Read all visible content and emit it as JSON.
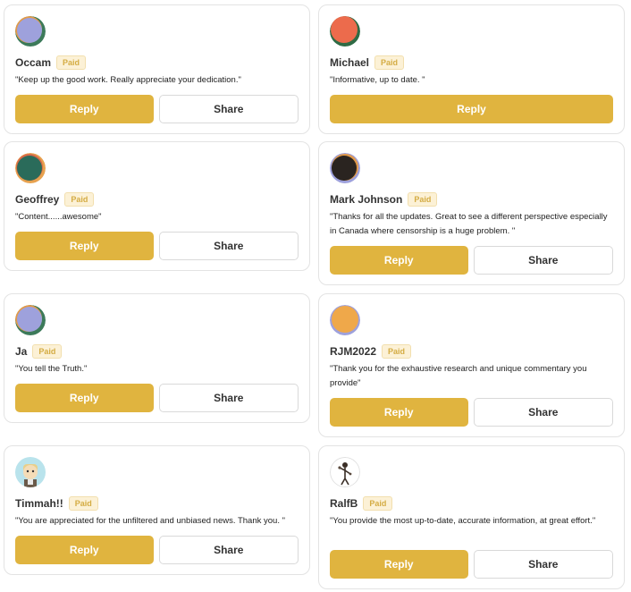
{
  "comments": [
    {
      "name": "Occam",
      "badge": "Paid",
      "text": "\"Keep up the good work. Really appreciate your dedication.\"",
      "reply": "Reply",
      "share": "Share"
    },
    {
      "name": "Michael",
      "badge": "Paid",
      "text": "\"Informative, up to date. \"",
      "reply": "Reply"
    },
    {
      "name": "Geoffrey",
      "badge": "Paid",
      "text": "\"Content......awesome\"",
      "reply": "Reply",
      "share": "Share"
    },
    {
      "name": "Mark Johnson",
      "badge": "Paid",
      "text": "\"Thanks for all the updates. Great to see a different perspective especially in Canada where censorship is a huge problem. \"",
      "reply": "Reply",
      "share": "Share"
    },
    {
      "name": "Ja",
      "badge": "Paid",
      "text": "\"You tell the Truth.\"",
      "reply": "Reply",
      "share": "Share"
    },
    {
      "name": "RJM2022",
      "badge": "Paid",
      "text": "\"Thank you for the exhaustive research and unique commentary you provide\"",
      "reply": "Reply",
      "share": "Share"
    },
    {
      "name": "Timmah!!",
      "badge": "Paid",
      "text": "\"You are appreciated for the unfiltered and unbiased news. Thank you. \"",
      "reply": "Reply",
      "share": "Share"
    },
    {
      "name": "RalfB",
      "badge": "Paid",
      "text": "\"You provide the most up-to-date, accurate information, at great effort.\"",
      "reply": "Reply",
      "share": "Share"
    }
  ],
  "avatars": [
    {
      "icon": "purple-circle-avatar-icon",
      "color": "#9ea1dc"
    },
    {
      "icon": "orange-circle-avatar-icon",
      "color": "#ec6b4c"
    },
    {
      "icon": "teal-circle-avatar-icon",
      "color": "#2a6b5a"
    },
    {
      "icon": "dark-circle-avatar-icon",
      "color": "#2a2420"
    },
    {
      "icon": "purple-circle-avatar-icon",
      "color": "#9ea1dc"
    },
    {
      "icon": "orange-circle-avatar-icon",
      "color": "#efa84a"
    },
    {
      "icon": "cartoon-avatar-icon",
      "color": "#b9e3ec"
    },
    {
      "icon": "sketch-avatar-icon",
      "color": "#ffffff"
    }
  ],
  "colors": {
    "accent": "#e0b43f",
    "badge_bg": "#fcf1d6",
    "badge_text": "#d4ac43"
  }
}
